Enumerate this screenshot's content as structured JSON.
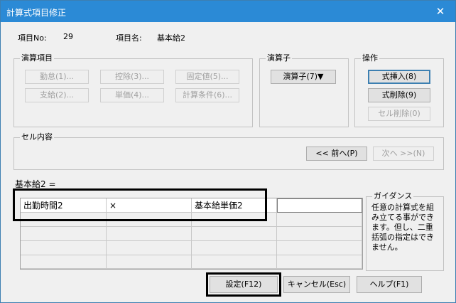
{
  "window": {
    "title": "計算式項目修正",
    "close_glyph": "✕"
  },
  "item": {
    "no_label": "項目No:",
    "no_value": "29",
    "name_label": "項目名:",
    "name_value": "基本給2"
  },
  "groups": {
    "items_title": "演算項目",
    "items_buttons": [
      "勤怠(1)...",
      "控除(3)...",
      "固定値(5)...",
      "支給(2)...",
      "単価(4)...",
      "計算条件(6)..."
    ],
    "operator_title": "演算子",
    "operator_button": "演算子(7)▼",
    "ops_title": "操作",
    "ops_buttons": [
      "式挿入(8)",
      "式削除(9)",
      "セル削除(0)"
    ],
    "cell_title": "セル内容",
    "prev_button": "<< 前へ(P)",
    "next_button": "次へ >>(N)"
  },
  "formula": {
    "label": "基本給2 =",
    "cells": [
      "出勤時間2",
      "×",
      "基本給単価2",
      ""
    ]
  },
  "guide": {
    "title": "ガイダンス",
    "text": "任意の計算式を組み立てる事ができます。但し、二重括弧の指定はできません。"
  },
  "footer": {
    "ok": "設定(F12)",
    "cancel": "キャンセル(Esc)",
    "help": "ヘルプ(F1)"
  }
}
